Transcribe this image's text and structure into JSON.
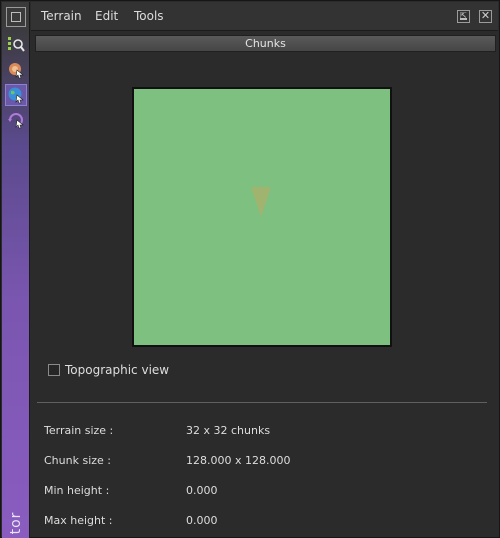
{
  "menu": {
    "items": [
      {
        "label": "Terrain"
      },
      {
        "label": "Edit"
      },
      {
        "label": "Tools"
      }
    ]
  },
  "tools": [
    {
      "name": "chunk-select-tool",
      "icon": "magnifier-grid-icon"
    },
    {
      "name": "paint-tool",
      "icon": "brush-cursor-icon"
    },
    {
      "name": "globe-tool",
      "icon": "globe-cursor-icon",
      "active": true
    },
    {
      "name": "rotate-tool",
      "icon": "rotate-cursor-icon"
    }
  ],
  "strip_label": "tor",
  "panel": {
    "title": "Chunks"
  },
  "minimap": {
    "terrain_color": "#7dc080",
    "marker_color": "#a4b36e"
  },
  "options": {
    "topographic_label": "Topographic view",
    "topographic_checked": false
  },
  "info": {
    "terrain_size": {
      "label": "Terrain size :",
      "value": "32 x 32 chunks"
    },
    "chunk_size": {
      "label": "Chunk size :",
      "value": "128.000 x 128.000"
    },
    "min_height": {
      "label": "Min height :",
      "value": "0.000"
    },
    "max_height": {
      "label": "Max height :",
      "value": "0.000"
    }
  },
  "colors": {
    "accent_purple": "#7a56b0",
    "panel_bg": "#2b2b2b"
  }
}
